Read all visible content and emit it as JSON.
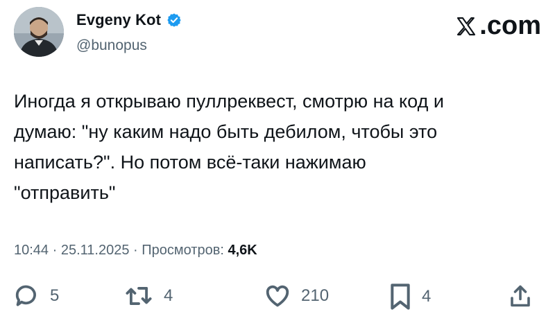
{
  "author": {
    "name": "Evgeny Kot",
    "handle": "@bunopus",
    "verified": true
  },
  "brand": {
    "label": ".com"
  },
  "tweet": {
    "text": "Иногда я открываю пуллреквест, смотрю на код и\nдумаю: \"ну каким надо быть дебилом, чтобы это\nнаписать?\". Но потом всё-таки нажимаю\n\"отправить\""
  },
  "meta": {
    "time": "10:44",
    "sep1": " · ",
    "date": "25.11.2025",
    "sep2": " · ",
    "views_label": "Просмотров: ",
    "views_count": "4,6K"
  },
  "actions": {
    "replies": "5",
    "reposts": "4",
    "likes": "210",
    "bookmarks": "4"
  },
  "colors": {
    "verified": "#1d9bf0",
    "muted": "#536471",
    "text": "#0f1419"
  },
  "icons": [
    "verified-badge-icon",
    "x-logo-icon",
    "reply-icon",
    "repost-icon",
    "like-icon",
    "bookmark-icon",
    "share-icon"
  ]
}
